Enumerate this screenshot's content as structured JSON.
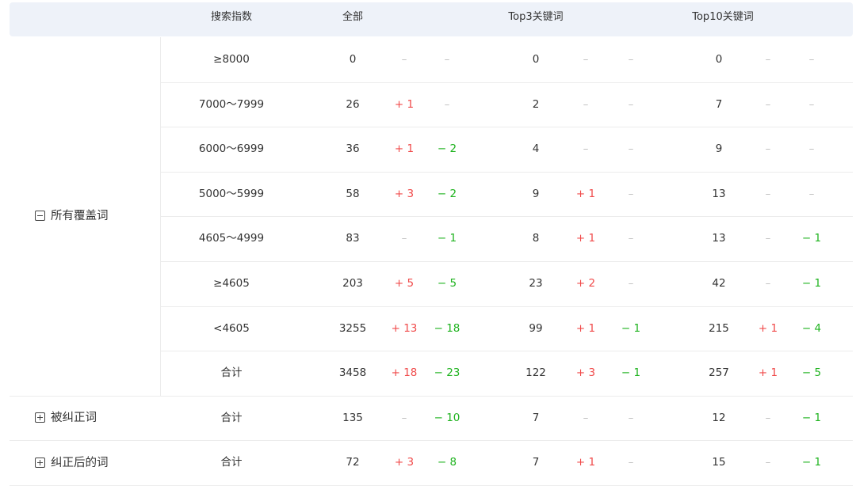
{
  "header": {
    "search_index": "搜索指数",
    "all": "全部",
    "top3": "Top3关键词",
    "top10": "Top10关键词"
  },
  "dash": "–",
  "groups": [
    {
      "label": "所有覆盖词",
      "toggle": "minus-box-icon",
      "rows": [
        {
          "index": "≥8000",
          "all": "0",
          "all_up": "",
          "all_dn": "",
          "t3": "0",
          "t3_up": "",
          "t3_dn": "",
          "t10": "0",
          "t10_up": "",
          "t10_dn": ""
        },
        {
          "index": "7000～7999",
          "all": "26",
          "all_up": "+ 1",
          "all_dn": "",
          "t3": "2",
          "t3_up": "",
          "t3_dn": "",
          "t10": "7",
          "t10_up": "",
          "t10_dn": ""
        },
        {
          "index": "6000～6999",
          "all": "36",
          "all_up": "+ 1",
          "all_dn": "− 2",
          "t3": "4",
          "t3_up": "",
          "t3_dn": "",
          "t10": "9",
          "t10_up": "",
          "t10_dn": ""
        },
        {
          "index": "5000～5999",
          "all": "58",
          "all_up": "+ 3",
          "all_dn": "− 2",
          "t3": "9",
          "t3_up": "+ 1",
          "t3_dn": "",
          "t10": "13",
          "t10_up": "",
          "t10_dn": ""
        },
        {
          "index": "4605～4999",
          "all": "83",
          "all_up": "",
          "all_dn": "− 1",
          "t3": "8",
          "t3_up": "+ 1",
          "t3_dn": "",
          "t10": "13",
          "t10_up": "",
          "t10_dn": "− 1"
        },
        {
          "index": "≥4605",
          "all": "203",
          "all_up": "+ 5",
          "all_dn": "− 5",
          "t3": "23",
          "t3_up": "+ 2",
          "t3_dn": "",
          "t10": "42",
          "t10_up": "",
          "t10_dn": "− 1"
        },
        {
          "index": "<4605",
          "all": "3255",
          "all_up": "+ 13",
          "all_dn": "− 18",
          "t3": "99",
          "t3_up": "+ 1",
          "t3_dn": "− 1",
          "t10": "215",
          "t10_up": "+ 1",
          "t10_dn": "− 4"
        },
        {
          "index": "合计",
          "all": "3458",
          "all_up": "+ 18",
          "all_dn": "− 23",
          "t3": "122",
          "t3_up": "+ 3",
          "t3_dn": "− 1",
          "t10": "257",
          "t10_up": "+ 1",
          "t10_dn": "− 5"
        }
      ]
    },
    {
      "label": "被纠正词",
      "toggle": "plus-box-icon",
      "rows": [
        {
          "index": "合计",
          "all": "135",
          "all_up": "",
          "all_dn": "− 10",
          "t3": "7",
          "t3_up": "",
          "t3_dn": "",
          "t10": "12",
          "t10_up": "",
          "t10_dn": "− 1"
        }
      ]
    },
    {
      "label": "纠正后的词",
      "toggle": "plus-box-icon",
      "rows": [
        {
          "index": "合计",
          "all": "72",
          "all_up": "+ 3",
          "all_dn": "− 8",
          "t3": "7",
          "t3_up": "+ 1",
          "t3_dn": "",
          "t10": "15",
          "t10_up": "",
          "t10_dn": "− 1"
        }
      ]
    }
  ],
  "colors": {
    "up": "#f04b4b",
    "down": "#1fb31f",
    "dash": "#c0c0c0",
    "header_bg": "#eef2f9"
  }
}
